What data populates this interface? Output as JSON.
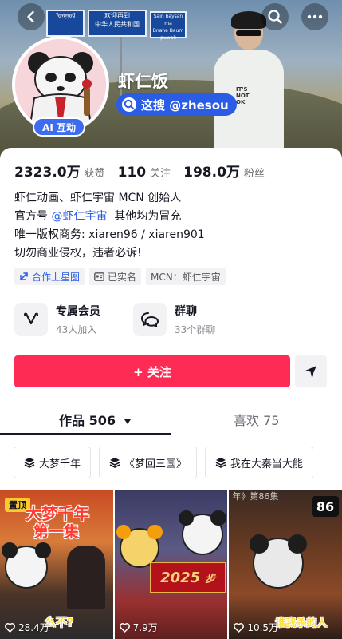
{
  "header": {
    "signs": {
      "left_top": "ᠮᠣᠩᠭᠣᠯ",
      "center_top": "欢迎再到",
      "center_bottom": "中华人民共和国",
      "right_top": "Sain baysan ma",
      "right_bottom": "Bnahe Baum puwak"
    },
    "person_shirt_text": "IT'S NOT OK"
  },
  "profile": {
    "nickname": "虾仁饭",
    "search_pill": "这搜 @zhesou",
    "ai_badge": "AI 互动"
  },
  "stats": [
    {
      "value": "2323.0万",
      "label": "获赞"
    },
    {
      "value": "110",
      "label": "关注"
    },
    {
      "value": "198.0万",
      "label": "粉丝"
    }
  ],
  "bio": {
    "line1": "虾仁动画、虾仁宇宙 MCN 创始人",
    "line2_prefix": "官方号 ",
    "line2_link": "@虾仁宇宙",
    "line2_suffix": "  其他均为冒充",
    "line3": "唯一版权商务: xiaren96 / xiaren901",
    "line4": "切勿商业侵权，违者必诉!"
  },
  "tags": [
    {
      "label": "合作上星图",
      "icon": "link-icon"
    },
    {
      "label": "已实名",
      "icon": "id-card-icon"
    },
    {
      "label": "MCN：虾仁宇宙",
      "icon": ""
    }
  ],
  "features": {
    "member": {
      "title": "专属会员",
      "sub": "43人加入"
    },
    "group": {
      "title": "群聊",
      "sub": "33个群聊"
    }
  },
  "actions": {
    "follow_label": "+ 关注"
  },
  "tabs": {
    "works": "作品 506",
    "likes": "喜欢 75"
  },
  "collections": [
    {
      "label": "大梦千年"
    },
    {
      "label": "《梦回三国》"
    },
    {
      "label": "我在大秦当大能"
    }
  ],
  "videos": [
    {
      "pin": "置顶",
      "title_line1": "大梦千年",
      "title_line2": "第一集",
      "caption": "么不?",
      "likes": "28.4万"
    },
    {
      "year": "2025",
      "year_suffix": "步",
      "likes": "7.9万"
    },
    {
      "episode_label": "年》第86集",
      "episode_num": "86",
      "caption": "谁我杀的人",
      "likes": "10.5万"
    }
  ],
  "colors": {
    "follow": "#fe2c55",
    "brand_blue": "#2a5ce6",
    "pin_badge": "#fecb2f"
  }
}
